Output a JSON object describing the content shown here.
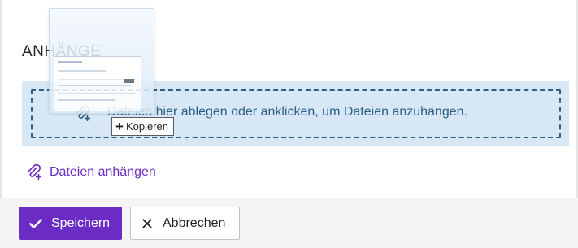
{
  "section": {
    "title": "ANHÄNGE"
  },
  "dropzone": {
    "text": "Dateien hier ablegen oder anklicken, um Dateien anzuhängen.",
    "icon": "paperclip-plus-icon"
  },
  "drag": {
    "badge_label": "Kopieren",
    "badge_icon": "plus-icon"
  },
  "attach": {
    "label": "Dateien anhängen",
    "icon": "paperclip-plus-icon"
  },
  "footer": {
    "save_label": "Speichern",
    "save_icon": "check-icon",
    "cancel_label": "Abbrechen",
    "cancel_icon": "close-icon"
  },
  "colors": {
    "accent": "#6a2cc4",
    "dropzone_bg": "#d7e7f6",
    "dropzone_border": "#2b5f86"
  }
}
